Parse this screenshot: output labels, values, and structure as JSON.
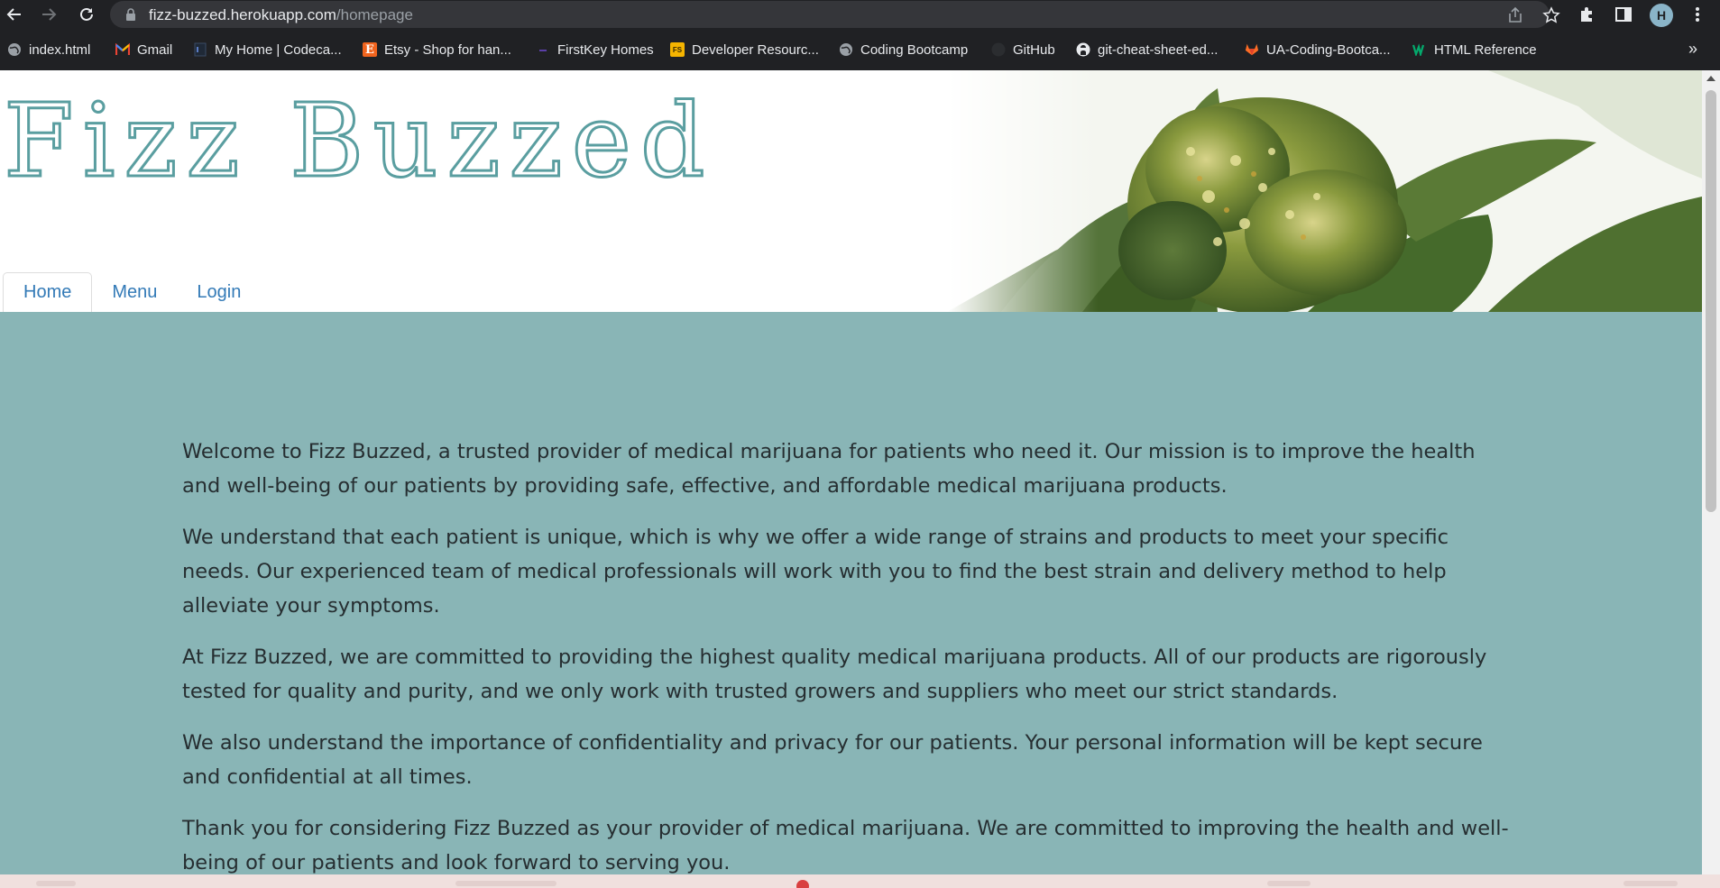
{
  "browser": {
    "url_host": "fizz-buzzed.herokuapp.com",
    "url_path": "/homepage",
    "profile_initial": "H",
    "bookmarks": [
      {
        "label": "index.html",
        "icon": "globe-icon"
      },
      {
        "label": "Gmail",
        "icon": "gmail-icon"
      },
      {
        "label": "My Home | Codeca...",
        "icon": "codecademy-icon"
      },
      {
        "label": "Etsy - Shop for han...",
        "icon": "etsy-icon"
      },
      {
        "label": "FirstKey Homes",
        "icon": "firstkey-icon"
      },
      {
        "label": "Developer Resourc...",
        "icon": "fs-icon"
      },
      {
        "label": "Coding Bootcamp",
        "icon": "globe-icon"
      },
      {
        "label": "GitHub",
        "icon": "github-icon"
      },
      {
        "label": "git-cheat-sheet-ed...",
        "icon": "github-icon"
      },
      {
        "label": "UA-Coding-Bootca...",
        "icon": "gitlab-icon"
      },
      {
        "label": "HTML Reference",
        "icon": "w3-icon"
      }
    ],
    "etsy_glyph": "E",
    "fs_glyph": "FS",
    "more_glyph": "»"
  },
  "site": {
    "title": "Fizz Buzzed",
    "title_color": "#5a9ea0",
    "content_bg": "#89b5b6",
    "link_color": "#337ab7",
    "nav": [
      {
        "label": "Home",
        "active": true
      },
      {
        "label": "Menu",
        "active": false
      },
      {
        "label": "Login",
        "active": false
      }
    ],
    "paragraphs": [
      "Welcome to Fizz Buzzed, a trusted provider of medical marijuana for patients who need it. Our mission is to improve the health and well-being of our patients by providing safe, effective, and affordable medical marijuana products.",
      "We understand that each patient is unique, which is why we offer a wide range of strains and products to meet your specific needs. Our experienced team of medical professionals will work with you to find the best strain and delivery method to help alleviate your symptoms.",
      "At Fizz Buzzed, we are committed to providing the highest quality medical marijuana products. All of our products are rigorously tested for quality and purity, and we only work with trusted growers and suppliers who meet our strict standards.",
      "We also understand the importance of confidentiality and privacy for our patients. Your personal information will be kept secure and confidential at all times.",
      "Thank you for considering Fizz Buzzed as your provider of medical marijuana. We are committed to improving the health and well-being of our patients and look forward to serving you."
    ]
  }
}
